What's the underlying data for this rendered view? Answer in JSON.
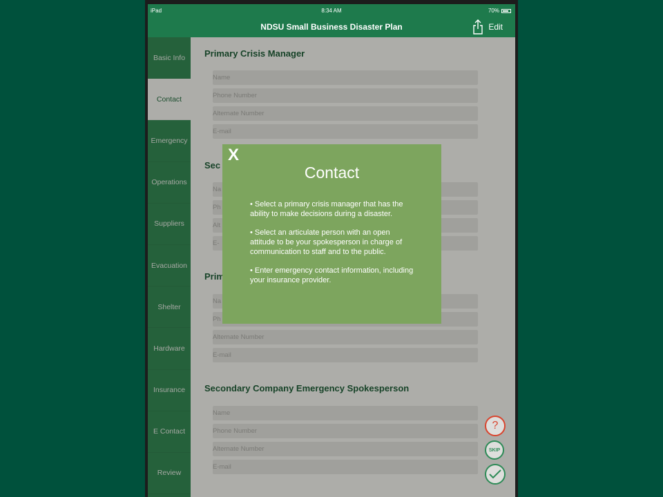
{
  "status": {
    "device": "iPad",
    "time": "8:34 AM",
    "battery": "70%",
    "battery_level": 0.7
  },
  "nav": {
    "title": "NDSU Small Business Disaster Plan",
    "edit_label": "Edit"
  },
  "sidebar": {
    "items": [
      {
        "label": "Basic Info"
      },
      {
        "label": "Contact"
      },
      {
        "label": "Emergency"
      },
      {
        "label": "Operations"
      },
      {
        "label": "Suppliers"
      },
      {
        "label": "Evacuation"
      },
      {
        "label": "Shelter"
      },
      {
        "label": "Hardware"
      },
      {
        "label": "Insurance"
      },
      {
        "label": "E Contact"
      },
      {
        "label": "Review"
      }
    ]
  },
  "form": {
    "sections": [
      {
        "title": "Primary Crisis Manager",
        "fields": [
          {
            "placeholder": "Name"
          },
          {
            "placeholder": "Phone Number"
          },
          {
            "placeholder": "Alternate Number"
          },
          {
            "placeholder": "E-mail"
          }
        ]
      },
      {
        "title": "Sec",
        "fields": [
          {
            "placeholder": "Na"
          },
          {
            "placeholder": "Ph"
          },
          {
            "placeholder": "Alt"
          },
          {
            "placeholder": "E-"
          }
        ]
      },
      {
        "title": "Prim",
        "fields": [
          {
            "placeholder": "Na"
          },
          {
            "placeholder": "Ph"
          },
          {
            "placeholder": "Alternate Number"
          },
          {
            "placeholder": "E-mail"
          }
        ]
      },
      {
        "title": "Secondary Company Emergency Spokesperson",
        "fields": [
          {
            "placeholder": "Name"
          },
          {
            "placeholder": "Phone Number"
          },
          {
            "placeholder": "Alternate Number"
          },
          {
            "placeholder": "E-mail"
          }
        ]
      }
    ]
  },
  "actions": {
    "help_label": "?",
    "skip_label": "SKIP"
  },
  "modal": {
    "close_label": "X",
    "title": "Contact",
    "bullets": [
      "• Select a primary crisis manager that has the ability to make decisions during a disaster.",
      "• Select an articulate person with an open attitude to be your spokesperson in charge of communication to staff and to the public.",
      "• Enter emergency contact information, including your insurance provider."
    ]
  },
  "colors": {
    "brand_green": "#1e7a4c",
    "sidebar_green": "#2e8b57",
    "modal_green": "#7da55e",
    "help_red": "#d9442e",
    "background": "#00513c"
  }
}
